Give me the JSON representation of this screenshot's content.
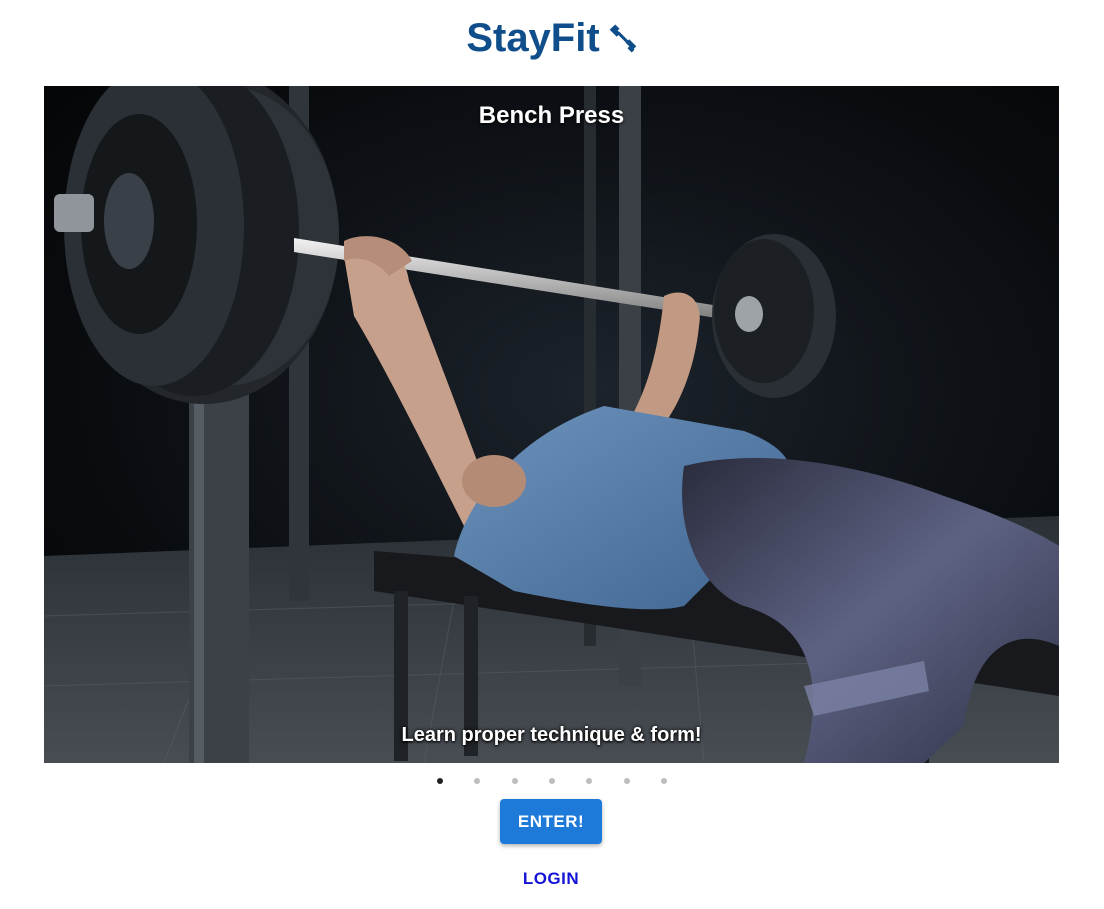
{
  "header": {
    "app_name": "StayFit",
    "logo_icon": "dumbbell-icon",
    "brand_color": "#0f4e8a"
  },
  "carousel": {
    "slide_title": "Bench Press",
    "slide_caption": "Learn proper technique & form!",
    "slide_count": 7,
    "active_index": 0,
    "image_description_icon": "bench-press-photo"
  },
  "actions": {
    "enter_label": "ENTER!",
    "login_label": "LOGIN",
    "enter_color": "#1e7ad9",
    "login_color": "#1414d6"
  }
}
